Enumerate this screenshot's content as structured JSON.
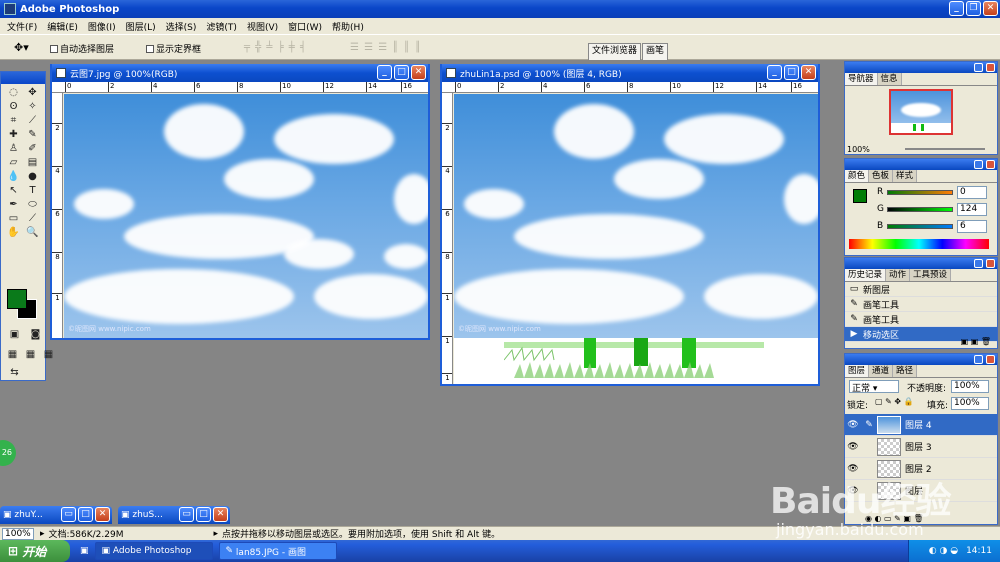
{
  "app": {
    "title": "Adobe Photoshop"
  },
  "menu": [
    "文件(F)",
    "编辑(E)",
    "图像(I)",
    "图层(L)",
    "选择(S)",
    "滤镜(T)",
    "视图(V)",
    "窗口(W)",
    "帮助(H)"
  ],
  "options": {
    "auto_select": "自动选择图层",
    "show_bounds": "显示定界框",
    "well_tabs": [
      "文件浏览器",
      "画笔"
    ]
  },
  "doc1": {
    "title": "云图7.jpg @ 100%(RGB)",
    "watermark": "©昵图网 www.nipic.com"
  },
  "doc2": {
    "title": "zhuLin1a.psd @ 100% (图层 4, RGB)",
    "watermark": "©昵图网 www.nipic.com"
  },
  "ruler_ticks": [
    "0",
    "2",
    "4",
    "6",
    "8",
    "10",
    "12",
    "14",
    "16"
  ],
  "ruler_vticks": [
    "2",
    "4",
    "6",
    "8",
    "1",
    "1",
    "1"
  ],
  "navigator": {
    "tabs": [
      "导航器",
      "信息"
    ],
    "zoom": "100%"
  },
  "color": {
    "tabs": [
      "颜色",
      "色板",
      "样式"
    ],
    "r_label": "R",
    "g_label": "G",
    "b_label": "B",
    "r": "0",
    "g": "124",
    "b": "6",
    "fg_hex": "#007c06"
  },
  "history": {
    "tabs": [
      "历史记录",
      "动作",
      "工具预设"
    ],
    "items": [
      "新图层",
      "画笔工具",
      "画笔工具",
      "移动选区"
    ]
  },
  "layers": {
    "tabs": [
      "图层",
      "通道",
      "路径"
    ],
    "blend": "正常",
    "opacity_label": "不透明度:",
    "opacity": "100%",
    "lock_label": "锁定:",
    "fill_label": "填充:",
    "fill": "100%",
    "items": [
      "图层 4",
      "图层 3",
      "图层 2",
      "图层"
    ]
  },
  "minimized": [
    "zhuY...",
    "zhuS..."
  ],
  "status": {
    "zoom": "100%",
    "doc": "文档:586K/2.29M",
    "hint": "点按并拖移以移动图层或选区。要用附加选项，使用 Shift 和 Alt 键。"
  },
  "taskbar": {
    "start": "开始",
    "tasks": [
      "Adobe Photoshop",
      "lan85.JPG - 画图"
    ],
    "clock": "14:11"
  },
  "badge": "26",
  "overlay": {
    "logo": "Baidu经验",
    "url": "jingyan.baidu.com"
  }
}
